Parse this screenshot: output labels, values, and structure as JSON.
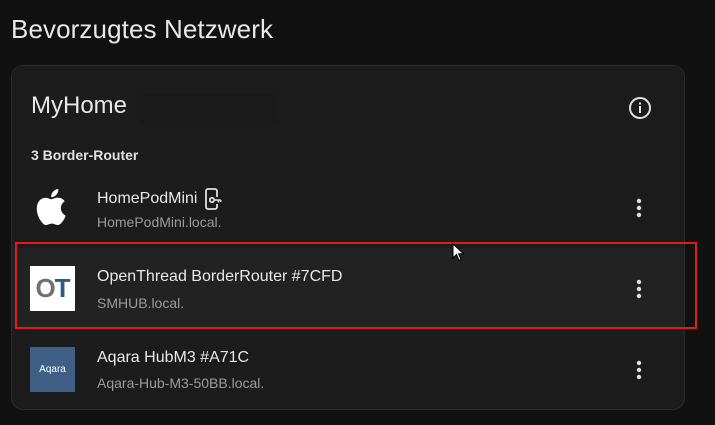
{
  "page": {
    "title": "Bevorzugtes Netzwerk"
  },
  "network": {
    "name": "MyHome",
    "section_label": "3 Border-Router"
  },
  "routers": [
    {
      "name": "HomePodMini",
      "host": "HomePodMini.local.",
      "logo": "apple-logo",
      "badge_icon": "cellphone-key-icon"
    },
    {
      "name": "OpenThread BorderRouter #7CFD",
      "host": "SMHUB.local.",
      "logo": "openthread-logo",
      "logo_text_o": "O",
      "logo_text_t": "T"
    },
    {
      "name": "Aqara HubM3 #A71C",
      "host": "Aqara-Hub-M3-50BB.local.",
      "logo": "aqara-logo",
      "logo_text": "Aqara"
    }
  ],
  "colors": {
    "background": "#111111",
    "card": "#1c1c1c",
    "highlight": "#e11b1b",
    "ot_blue": "#2a5d86",
    "aqara_blue": "#3f5f86"
  }
}
